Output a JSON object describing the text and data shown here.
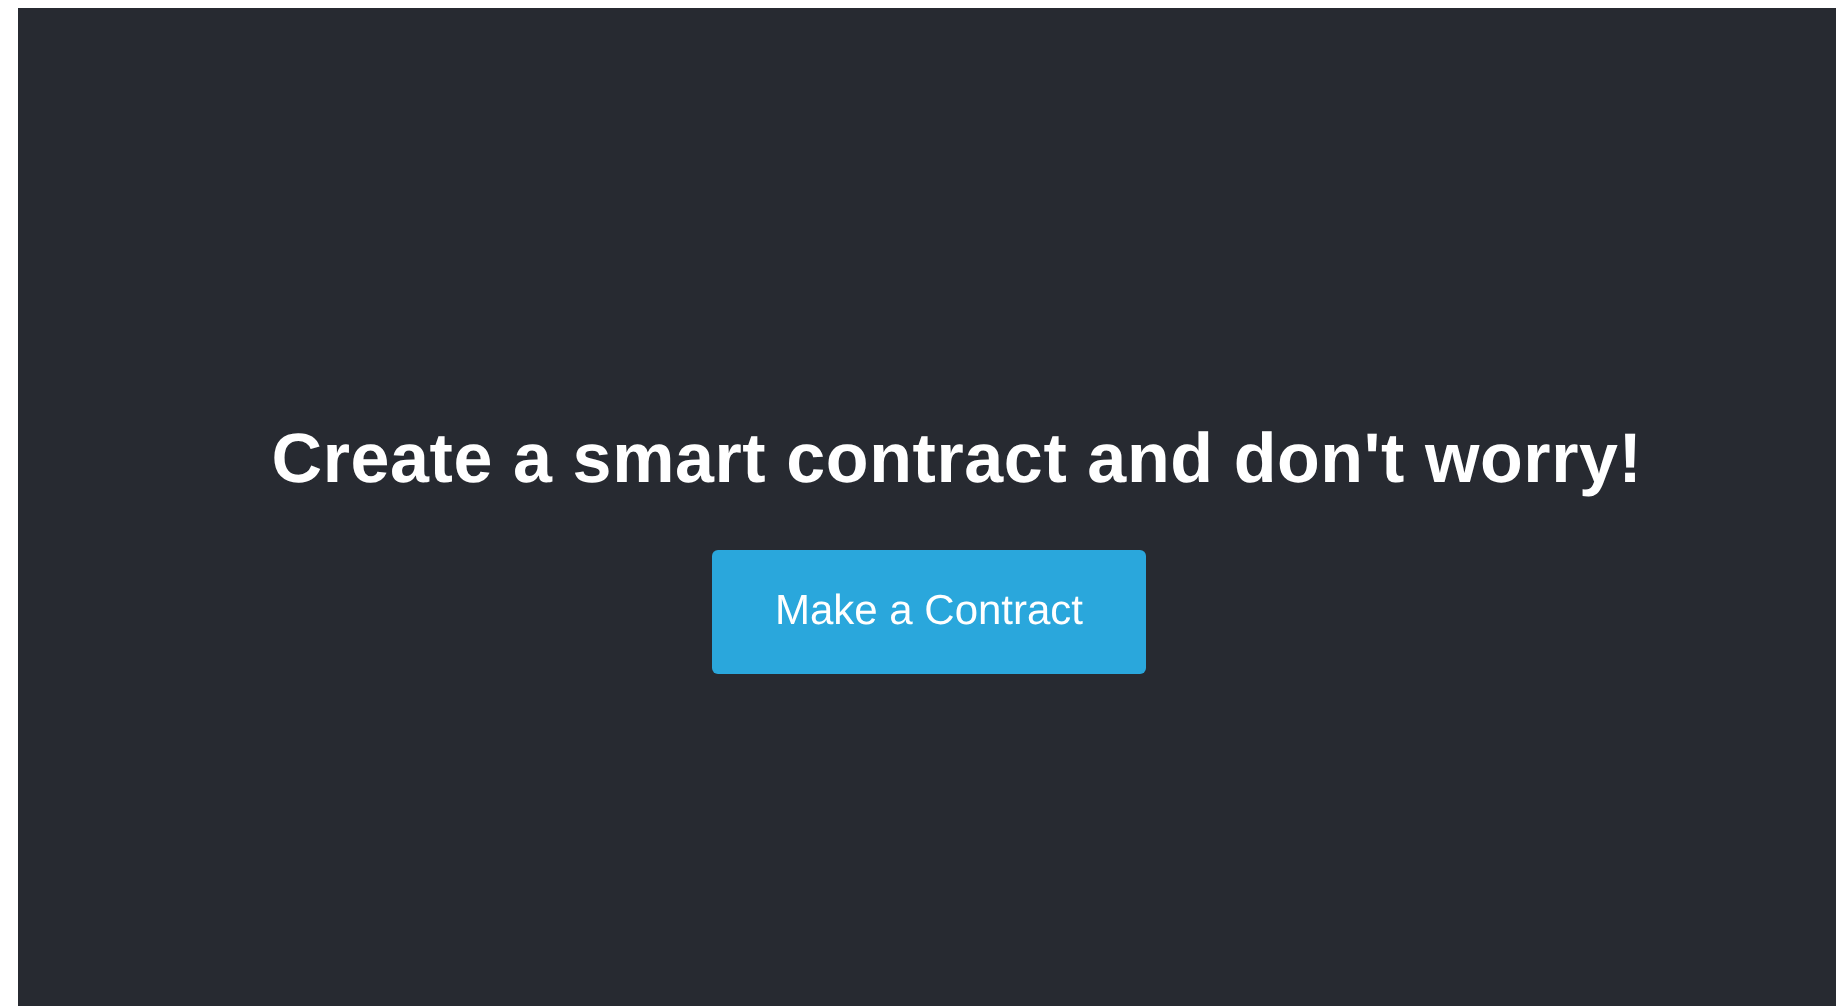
{
  "hero": {
    "headline": "Create a smart contract and don't worry!",
    "button": "Make a Contract"
  }
}
